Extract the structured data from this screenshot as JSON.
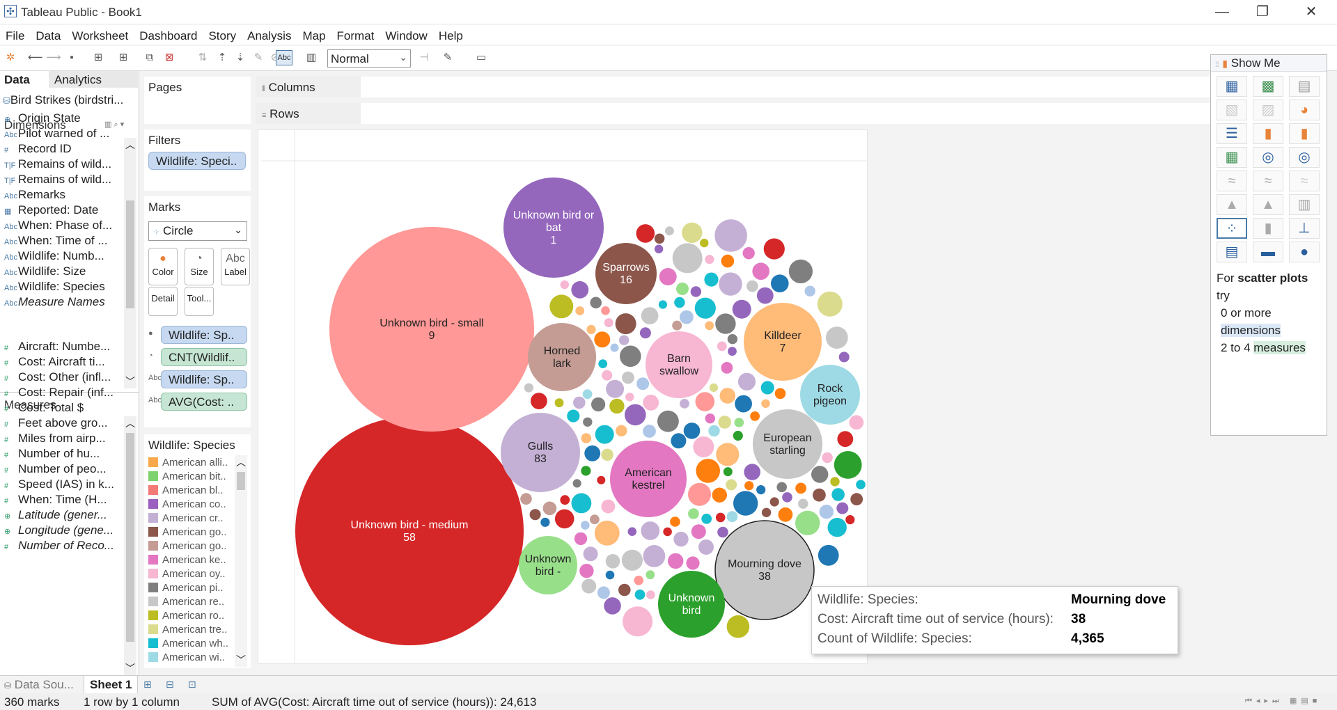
{
  "window": {
    "title": "Tableau Public - Book1",
    "minimize": "—",
    "restore": "❐",
    "close": "✕"
  },
  "menu": [
    "File",
    "Data",
    "Worksheet",
    "Dashboard",
    "Story",
    "Analysis",
    "Map",
    "Format",
    "Window",
    "Help"
  ],
  "toolbar": {
    "fit_mode": "Normal",
    "abc_label": "Abc"
  },
  "data_pane": {
    "tabs": [
      "Data",
      "Analytics"
    ],
    "datasource": "Bird Strikes (birdstri...",
    "dimensions_label": "Dimensions",
    "dimensions": [
      {
        "icon": "⊕",
        "label": "Origin State",
        "italic": false
      },
      {
        "icon": "Abc",
        "label": "Pilot warned of ...",
        "italic": false
      },
      {
        "icon": "#",
        "label": "Record ID",
        "italic": false
      },
      {
        "icon": "T|F",
        "label": "Remains of wild...",
        "italic": false
      },
      {
        "icon": "T|F",
        "label": "Remains of wild...",
        "italic": false
      },
      {
        "icon": "Abc",
        "label": "Remarks",
        "italic": false
      },
      {
        "icon": "▦",
        "label": "Reported: Date",
        "italic": false
      },
      {
        "icon": "Abc",
        "label": "When: Phase of...",
        "italic": false
      },
      {
        "icon": "Abc",
        "label": "When: Time of ...",
        "italic": false
      },
      {
        "icon": "Abc",
        "label": "Wildlife: Numb...",
        "italic": false
      },
      {
        "icon": "Abc",
        "label": "Wildlife: Size",
        "italic": false
      },
      {
        "icon": "Abc",
        "label": "Wildlife: Species",
        "italic": false
      },
      {
        "icon": "Abc",
        "label": "Measure Names",
        "italic": true
      }
    ],
    "measures_label": "Measures",
    "measures": [
      {
        "icon": "#",
        "label": "Aircraft: Numbe...",
        "italic": false
      },
      {
        "icon": "#",
        "label": "Cost: Aircraft ti...",
        "italic": false
      },
      {
        "icon": "#",
        "label": "Cost: Other (infl...",
        "italic": false
      },
      {
        "icon": "#",
        "label": "Cost: Repair (inf...",
        "italic": false
      },
      {
        "icon": "#",
        "label": "Cost: Total $",
        "italic": false
      },
      {
        "icon": "#",
        "label": "Feet above gro...",
        "italic": false
      },
      {
        "icon": "#",
        "label": "Miles from airp...",
        "italic": false
      },
      {
        "icon": "#",
        "label": "Number of hu...",
        "italic": false
      },
      {
        "icon": "#",
        "label": "Number of peo...",
        "italic": false
      },
      {
        "icon": "#",
        "label": "Speed (IAS) in k...",
        "italic": false
      },
      {
        "icon": "#",
        "label": "When: Time (H...",
        "italic": false
      },
      {
        "icon": "⊕",
        "label": "Latitude (gener...",
        "italic": true
      },
      {
        "icon": "⊕",
        "label": "Longitude (gene...",
        "italic": true
      },
      {
        "icon": "#",
        "label": "Number of Reco...",
        "italic": true
      }
    ]
  },
  "shelves": {
    "pages": "Pages",
    "filters": "Filters",
    "filter_pill": "Wildlife: Speci..",
    "columns": "Columns",
    "rows": "Rows"
  },
  "marks": {
    "title": "Marks",
    "type": "Circle",
    "buttons": [
      {
        "label": "Color",
        "icon": "●"
      },
      {
        "label": "Size",
        "icon": "◔"
      },
      {
        "label": "Label",
        "icon": "Abc"
      },
      {
        "label": "Detail",
        "icon": ""
      },
      {
        "label": "Tool...",
        "icon": ""
      }
    ],
    "pills": [
      {
        "label": "Wildlife: Sp..",
        "kind": "dim",
        "icon": "●"
      },
      {
        "label": "CNT(Wildlif..",
        "kind": "meas",
        "icon": "◔"
      },
      {
        "label": "Wildlife: Sp..",
        "kind": "dim",
        "icon": "Abc"
      },
      {
        "label": "AVG(Cost: ..",
        "kind": "meas",
        "icon": "Abc"
      }
    ]
  },
  "legend": {
    "title": "Wildlife: Species",
    "items": [
      {
        "label": "American alli..",
        "color": "#f7a84b"
      },
      {
        "label": "American bit..",
        "color": "#7fd36f"
      },
      {
        "label": "American bl..",
        "color": "#f27b78"
      },
      {
        "label": "American co..",
        "color": "#9b5fc0"
      },
      {
        "label": "American cr..",
        "color": "#c5b0d5"
      },
      {
        "label": "American go..",
        "color": "#8c564b"
      },
      {
        "label": "American go..",
        "color": "#c49c94"
      },
      {
        "label": "American ke..",
        "color": "#e377c2"
      },
      {
        "label": "American oy..",
        "color": "#f7b6d2"
      },
      {
        "label": "American pi..",
        "color": "#7f7f7f"
      },
      {
        "label": "American re..",
        "color": "#c7c7c7"
      },
      {
        "label": "American ro..",
        "color": "#bcbd22"
      },
      {
        "label": "American tre..",
        "color": "#dbdb8d"
      },
      {
        "label": "American wh..",
        "color": "#17becf"
      },
      {
        "label": "American wi..",
        "color": "#9edae5"
      }
    ]
  },
  "chart_data": {
    "type": "packed-bubble",
    "size_measure": "CNT(Wildlife: Species)",
    "label_measure": "AVG(Cost: Aircraft time out of service (hours))",
    "labeled_bubbles": [
      {
        "species": "Unknown bird - medium",
        "value": "58",
        "color": "#d62728",
        "text_color": "#ffffff"
      },
      {
        "species": "Unknown bird - small",
        "value": "9",
        "color": "#ff9896",
        "text_color": "#222222"
      },
      {
        "species": "Unknown bird or bat",
        "value": "1",
        "color": "#9467bd",
        "text_color": "#ffffff"
      },
      {
        "species": "Sparrows",
        "value": "16",
        "color": "#8c564b",
        "text_color": "#ffffff"
      },
      {
        "species": "Horned lark",
        "value": "",
        "color": "#c49c94",
        "text_color": "#222222"
      },
      {
        "species": "Barn swallow",
        "value": "",
        "color": "#f7b6d2",
        "text_color": "#222222"
      },
      {
        "species": "Killdeer",
        "value": "7",
        "color": "#ffbb78",
        "text_color": "#222222"
      },
      {
        "species": "Rock pigeon",
        "value": "",
        "color": "#9edae5",
        "text_color": "#222222"
      },
      {
        "species": "Gulls",
        "value": "83",
        "color": "#c5b0d5",
        "text_color": "#222222"
      },
      {
        "species": "American kestrel",
        "value": "",
        "color": "#e377c2",
        "text_color": "#222222"
      },
      {
        "species": "European starling",
        "value": "",
        "color": "#c7c7c7",
        "text_color": "#222222"
      },
      {
        "species": "Unknown bird -",
        "value": "",
        "color": "#98df8a",
        "text_color": "#222222"
      },
      {
        "species": "Mourning dove",
        "value": "38",
        "color": "#c7c7c7",
        "text_color": "#222222"
      },
      {
        "species": "Unknown bird",
        "value": "",
        "color": "#2ca02c",
        "text_color": "#ffffff"
      }
    ],
    "palette": [
      "#1f77b4",
      "#aec7e8",
      "#ff7f0e",
      "#ffbb78",
      "#2ca02c",
      "#98df8a",
      "#d62728",
      "#ff9896",
      "#9467bd",
      "#c5b0d5",
      "#8c564b",
      "#c49c94",
      "#e377c2",
      "#f7b6d2",
      "#7f7f7f",
      "#c7c7c7",
      "#bcbd22",
      "#dbdb8d",
      "#17becf",
      "#9edae5"
    ]
  },
  "tooltip": {
    "rows": [
      {
        "label": "Wildlife: Species:",
        "value": "Mourning dove"
      },
      {
        "label": "Cost: Aircraft time out of service (hours):",
        "value": "38"
      },
      {
        "label": "Count of Wildlife: Species:",
        "value": "4,365"
      }
    ]
  },
  "showme": {
    "title": "Show Me",
    "hint_prefix": "For ",
    "hint_bold": "scatter plots",
    "hint_try": "try",
    "req1_prefix": "0 or more",
    "req1_key": "dimensions",
    "req2_prefix": "2 to 4 ",
    "req2_key": "measures"
  },
  "sheets": {
    "datasource_tab": "Data Sou...",
    "sheet_tab": "Sheet 1"
  },
  "status": {
    "marks": "360 marks",
    "dims": "1 row by 1 column",
    "sum": "SUM of AVG(Cost: Aircraft time out of service (hours)): 24,613"
  }
}
